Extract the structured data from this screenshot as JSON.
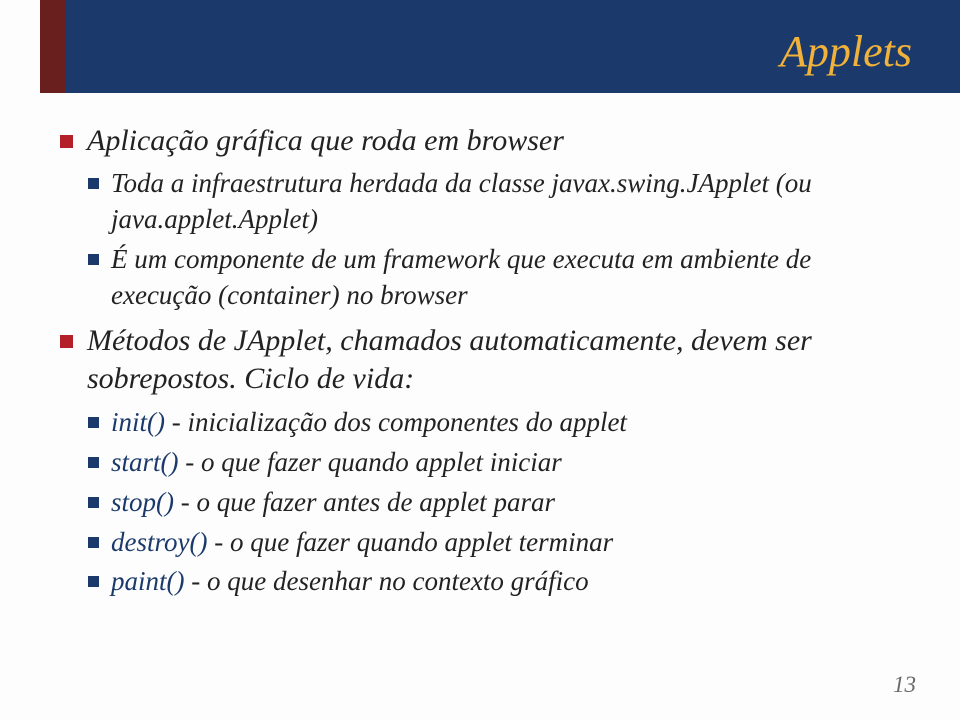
{
  "title": "Applets",
  "bullets": [
    {
      "text": "Aplicação gráfica que roda em browser",
      "children": [
        {
          "text": "Toda a infraestrutura herdada da classe javax.swing.JApplet (ou java.applet.Applet)"
        },
        {
          "text": "É um componente de um framework que executa em ambiente de execução (container) no browser"
        }
      ]
    },
    {
      "text": "Métodos de JApplet, chamados automaticamente, devem ser sobrepostos. Ciclo de vida:",
      "children": [
        {
          "method": "init()",
          "desc": " - inicialização dos componentes do applet"
        },
        {
          "method": "start()",
          "desc": " - o que fazer quando applet iniciar"
        },
        {
          "method": "stop()",
          "desc": " - o que fazer antes de applet parar"
        },
        {
          "method": "destroy()",
          "desc": " - o que fazer quando applet terminar"
        },
        {
          "method": "paint()",
          "desc": " - o que desenhar no contexto gráfico"
        }
      ]
    }
  ],
  "pageNumber": "13"
}
